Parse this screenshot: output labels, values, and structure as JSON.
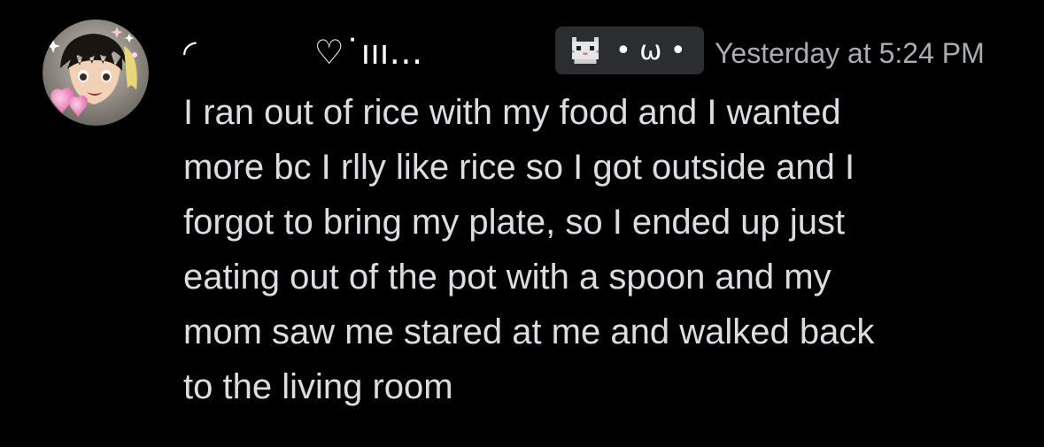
{
  "author": {
    "display_name": "◜           ♡˙ııı…",
    "avatar_icon": "anime-character-avatar-icon"
  },
  "tag": {
    "icon": "pixel-cat-icon",
    "text": "• ω •"
  },
  "timestamp": "Yesterday at 5:24 PM",
  "message": {
    "lines": [
      "I ran out of rice with my food and I wanted",
      "more bc I rlly like rice so I got outside and I",
      "forgot to bring my plate, so I ended up just",
      "eating out of the pot with a spoon and my",
      "mom saw me stared at me and walked back",
      "to the living room"
    ]
  },
  "colors": {
    "background": "#000000",
    "message_text": "#dcdde0",
    "timestamp_text": "#a9adb3",
    "tag_background": "#2b2d31"
  }
}
